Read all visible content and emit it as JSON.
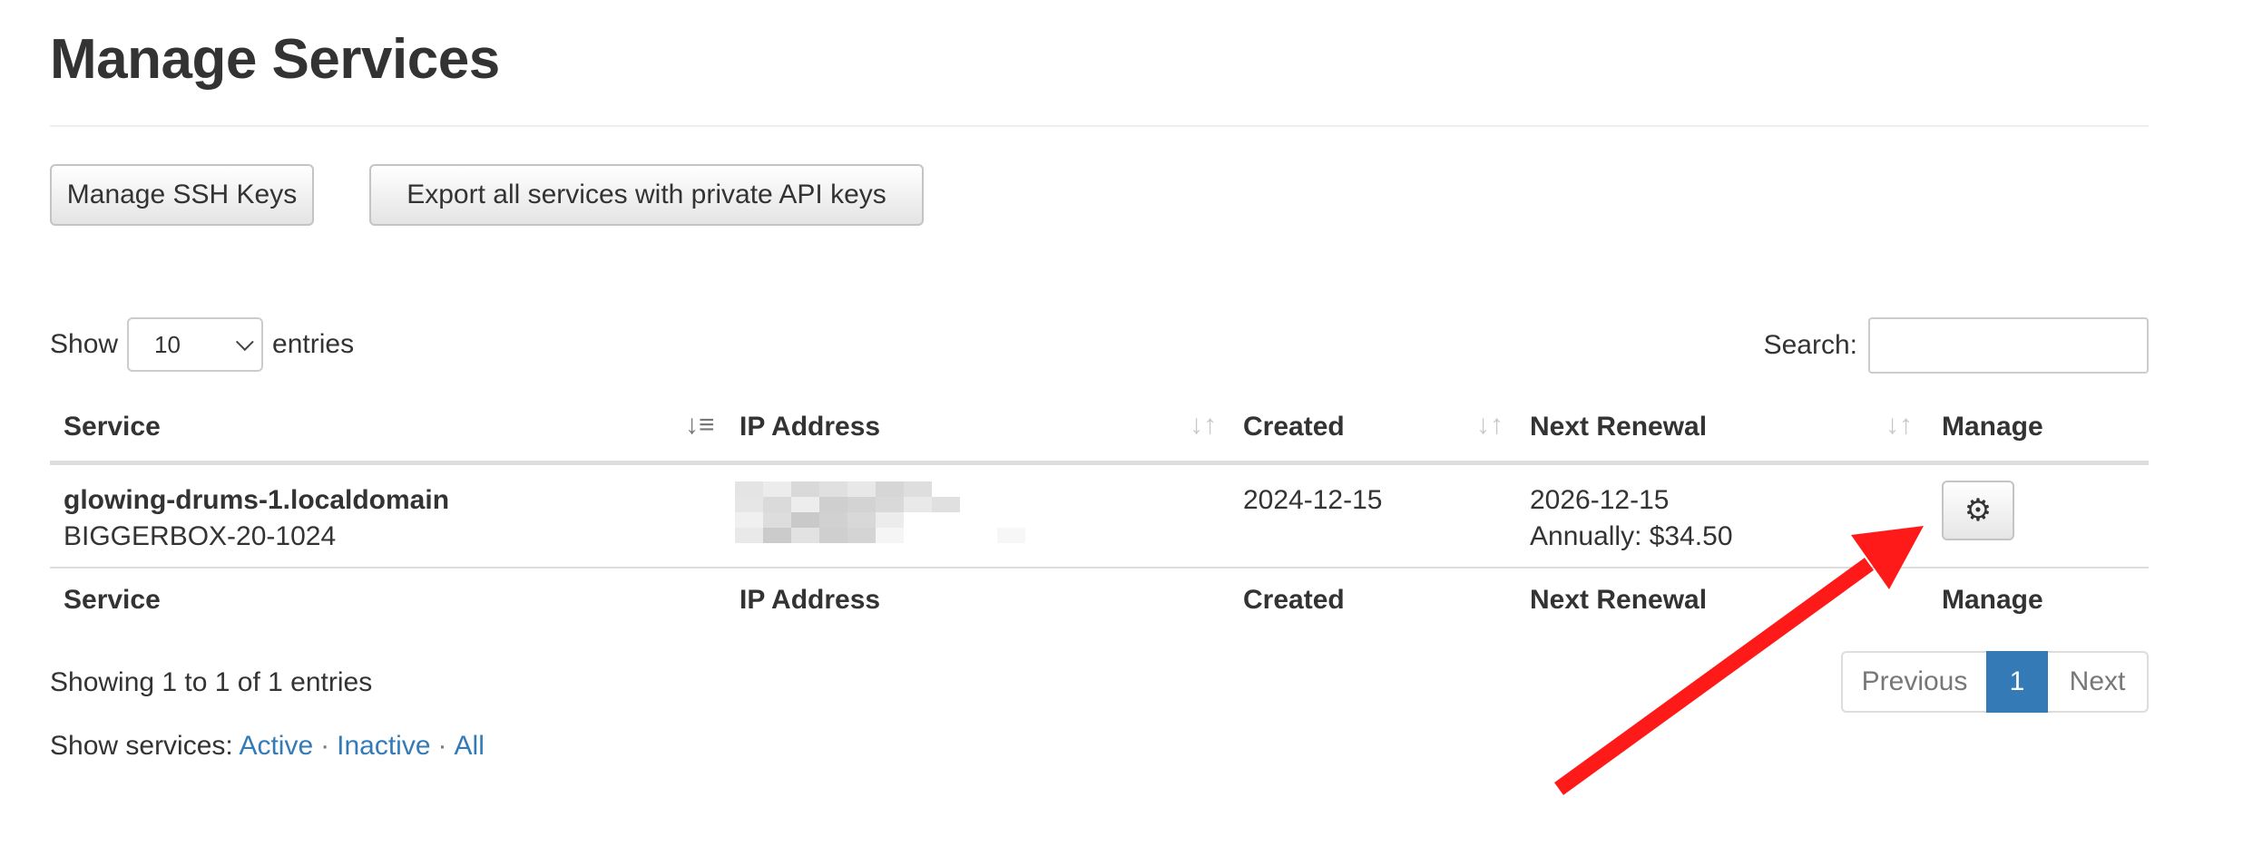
{
  "page": {
    "title": "Manage Services"
  },
  "actions": {
    "ssh_keys": "Manage SSH Keys",
    "export": "Export all services with private API keys"
  },
  "length_control": {
    "show": "Show",
    "value": "10",
    "entries": "entries"
  },
  "search": {
    "label": "Search:",
    "value": ""
  },
  "table": {
    "headers": [
      "Service",
      "IP Address",
      "Created",
      "Next Renewal",
      "Manage"
    ],
    "rows": [
      {
        "service_name": "glowing-drums-1.localdomain",
        "service_plan": "BIGGERBOX-20-1024",
        "ip_address": "",
        "created": "2024-12-15",
        "renewal_date": "2026-12-15",
        "renewal_price": "Annually: $34.50",
        "manage_icon": "gear-icon"
      }
    ]
  },
  "info": "Showing 1 to 1 of 1 entries",
  "pagination": {
    "previous": "Previous",
    "current": "1",
    "next": "Next"
  },
  "filters": {
    "label": "Show services:",
    "active": "Active",
    "inactive": "Inactive",
    "all": "All",
    "separator": "·"
  },
  "colors": {
    "link": "#337ab7",
    "annotation_arrow": "#ff1a1a"
  }
}
